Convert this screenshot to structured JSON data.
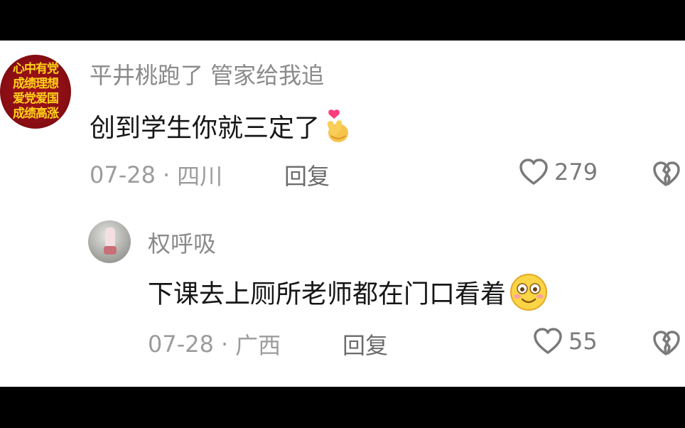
{
  "comment": {
    "avatar_lines": [
      "心中有党",
      "成绩理想",
      "爱党爱国",
      "成绩高涨"
    ],
    "username": "平井桃跑了 管家给我追",
    "text": "创到学生你就三定了",
    "emoji": "finger-heart-emoji",
    "date": "07-28",
    "location": "四川",
    "reply_label": "回复",
    "likes": "279"
  },
  "reply": {
    "username": "权呼吸",
    "text": "下课去上厕所老师都在门口看着",
    "emoji": "smiling-face-emoji",
    "date": "07-28",
    "location": "广西",
    "reply_label": "回复",
    "likes": "55"
  },
  "colors": {
    "background": "#000000",
    "panel": "#ffffff",
    "avatar_red": "#8a0e14",
    "avatar_text": "#ffd21a",
    "meta_gray": "#9c9c9c",
    "text": "#161616"
  }
}
